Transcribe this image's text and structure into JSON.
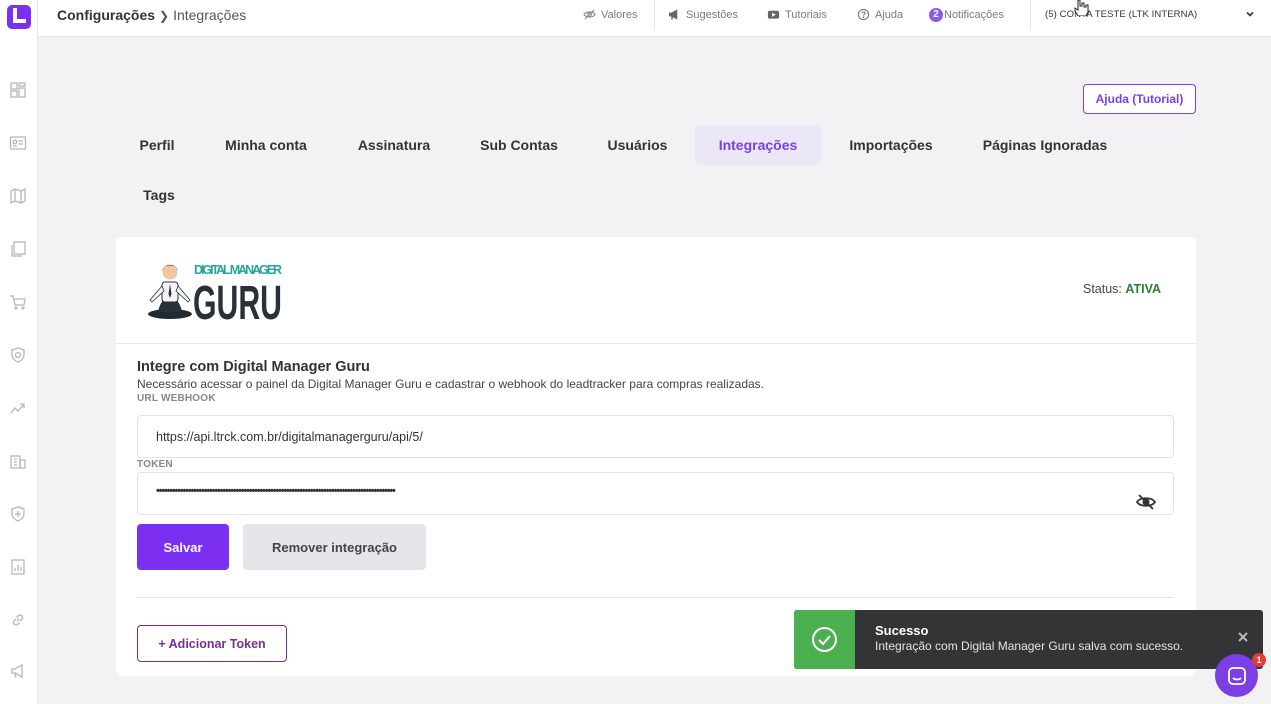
{
  "breadcrumb": {
    "section": "Configurações",
    "current": "Integrações"
  },
  "topnav": {
    "valores": "Valores",
    "sugestoes": "Sugestões",
    "tutoriais": "Tutoriais",
    "ajuda": "Ajuda",
    "notificacoes_count": "2",
    "notificacoes": "Notificações",
    "account": "(5) CONTA TESTE (LTK INTERNA)"
  },
  "help_button": "Ajuda (Tutorial)",
  "tabs": [
    {
      "label": "Perfil"
    },
    {
      "label": "Minha conta"
    },
    {
      "label": "Assinatura"
    },
    {
      "label": "Sub Contas"
    },
    {
      "label": "Usuários"
    },
    {
      "label": "Integrações",
      "active": true
    },
    {
      "label": "Importações"
    },
    {
      "label": "Páginas Ignoradas"
    },
    {
      "label": "Tags"
    }
  ],
  "integration": {
    "logo_text_top": "DIGITAL MANAGER",
    "logo_text_bottom": "GURU",
    "status_label": "Status:",
    "status_value": "ATIVA",
    "title": "Integre com Digital Manager Guru",
    "description": "Necessário acessar o painel da Digital Manager Guru e cadastrar o webhook do leadtracker para compras realizadas.",
    "webhook_label": "URL WEBHOOK",
    "webhook_value": "https://api.ltrck.com.br/digitalmanagerguru/api/5/",
    "token_label": "TOKEN",
    "token_value": "••••••••••••••••••••••••••••••••••••••••••••••••••••••••••••••••••••••••••••••••••••••••••",
    "save_label": "Salvar",
    "remove_label": "Remover integração",
    "add_token_label": "+ Adicionar Token"
  },
  "toast": {
    "title": "Sucesso",
    "message": "Integração com Digital Manager Guru salva com sucesso."
  },
  "chat": {
    "badge": "1"
  },
  "colors": {
    "accent": "#7b3fe4",
    "success": "#4caf50",
    "status_active": "#2e7d32",
    "tab_active_bg": "#ebe7f7"
  },
  "icons": {
    "sidebar": [
      "dashboard-icon",
      "contact-card-icon",
      "map-icon",
      "pages-icon",
      "cart-icon",
      "shield-check-icon",
      "trend-icon",
      "building-icon",
      "shield-plus-icon",
      "report-icon",
      "link-icon",
      "megaphone-icon"
    ],
    "topnav": [
      "eye-off-icon",
      "megaphone-icon",
      "youtube-icon",
      "help-circle-icon"
    ]
  }
}
